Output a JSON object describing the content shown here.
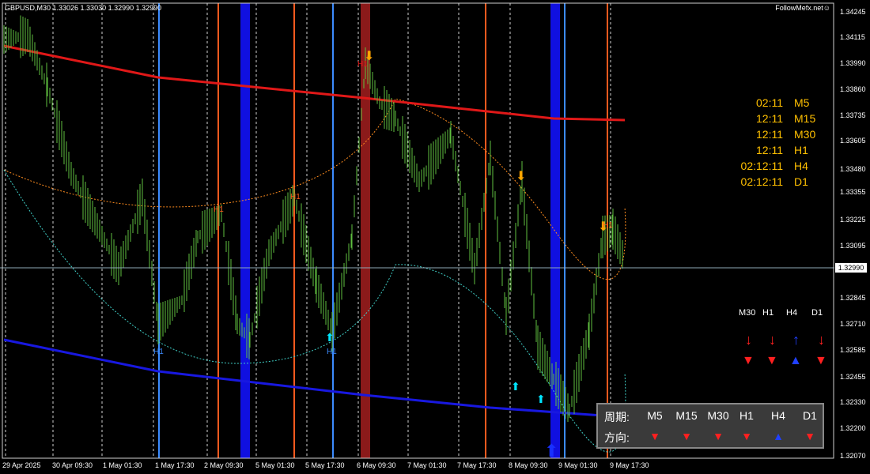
{
  "symbol_info": "GBPUSD,M30  1.33026 1.33030 1.32990 1.32990",
  "brand": "FollowMefx.net☺",
  "current_price": "1.32990",
  "price_labels": [
    "1.34245",
    "1.34115",
    "1.33990",
    "1.33860",
    "1.33735",
    "1.33605",
    "1.33480",
    "1.33355",
    "1.33225",
    "1.33095",
    "1.32845",
    "1.32710",
    "1.32585",
    "1.32455",
    "1.32330",
    "1.32200",
    "1.32070"
  ],
  "time_labels": [
    "29 Apr 2025",
    "30 Apr 09:30",
    "1 May 01:30",
    "1 May 17:30",
    "2 May 09:30",
    "5 May 01:30",
    "5 May 17:30",
    "6 May 09:30",
    "7 May 01:30",
    "7 May 17:30",
    "8 May 09:30",
    "9 May 01:30",
    "9 May 17:30"
  ],
  "tf_timers": [
    {
      "time": "02:11",
      "tf": "M5"
    },
    {
      "time": "12:11",
      "tf": "M15"
    },
    {
      "time": "12:11",
      "tf": "M30"
    },
    {
      "time": "12:11",
      "tf": "H1"
    },
    {
      "time": "02:12:11",
      "tf": "H4"
    },
    {
      "time": "02:12:11",
      "tf": "D1"
    }
  ],
  "mtf_arrows": {
    "headers": [
      "M30",
      "H1",
      "H4",
      "D1"
    ],
    "arrows": [
      "↓",
      "↓",
      "↑",
      "↓"
    ],
    "triangles": [
      "▼",
      "▼",
      "▲",
      "▼"
    ],
    "colors": [
      "#ff2020",
      "#ff2020",
      "#2040ff",
      "#ff2020"
    ]
  },
  "panel": {
    "period_label": "周期:",
    "direction_label": "方向:",
    "periods": [
      "M5",
      "M15",
      "M30",
      "H1",
      "H4",
      "D1"
    ],
    "directions": [
      "▼",
      "▼",
      "▼",
      "▼",
      "▲",
      "▼"
    ],
    "direction_colors": [
      "#ff2020",
      "#ff2020",
      "#ff2020",
      "#ff2020",
      "#2040ff",
      "#ff2020"
    ]
  },
  "chart_data": {
    "type": "line",
    "symbol": "GBPUSD",
    "timeframe": "M30",
    "ylim": [
      1.3207,
      1.34245
    ],
    "series_color": "#5fbf3f",
    "signal_labels": [
      "H1",
      "H1",
      "H1",
      "H1",
      "H1",
      "H1"
    ]
  }
}
